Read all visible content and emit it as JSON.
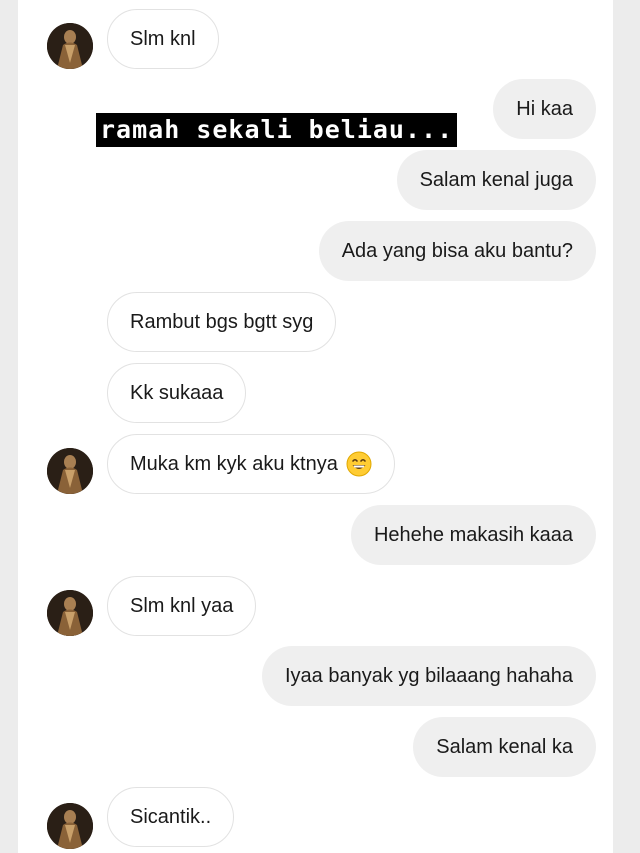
{
  "conversation": {
    "messages": [
      {
        "side": "in",
        "text": "Slm knl",
        "avatar": true
      },
      {
        "side": "out",
        "text": "Hi kaa"
      },
      {
        "side": "out",
        "text": "Salam kenal juga"
      },
      {
        "side": "out",
        "text": "Ada yang bisa aku bantu?"
      },
      {
        "side": "in",
        "text": "Rambut bgs bgtt syg",
        "avatar": false
      },
      {
        "side": "in",
        "text": "Kk sukaaa",
        "avatar": false
      },
      {
        "side": "in",
        "text": "Muka km kyk aku ktnya",
        "emoji": "grinning-face-emoji",
        "avatar": true
      },
      {
        "side": "out",
        "text": "Hehehe makasih kaaa"
      },
      {
        "side": "in",
        "text": "Slm knl yaa",
        "avatar": true
      },
      {
        "side": "out",
        "text": "Iyaa banyak yg bilaaang hahaha"
      },
      {
        "side": "out",
        "text": "Salam kenal ka"
      },
      {
        "side": "in",
        "text": "Sicantik..",
        "avatar": true
      }
    ]
  },
  "overlay": {
    "caption": "ramah sekali beliau..."
  },
  "colors": {
    "incoming_bubble": "#ffffff",
    "incoming_border": "#e2e2e2",
    "outgoing_bubble": "#efefef",
    "text": "#1a1a1a",
    "caption_bg": "#000000",
    "caption_text": "#ffffff"
  }
}
